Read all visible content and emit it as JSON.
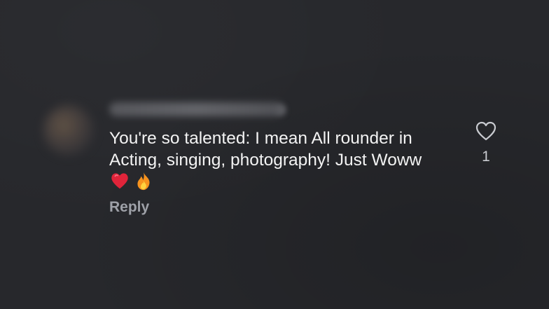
{
  "comment": {
    "text": "You're so talented: I mean All rounder in\nActing, singing, photography! Just Woww",
    "emojis": [
      "heart-emoji",
      "fire-emoji"
    ],
    "reply_label": "Reply",
    "like_count": "1",
    "like_icon": "heart-outline-icon"
  },
  "colors": {
    "background": "#27282c",
    "text": "#f3f3f3",
    "secondary_text": "#9ea1a8",
    "heart_red": "#e0243a",
    "fire_orange": "#f7931e"
  }
}
